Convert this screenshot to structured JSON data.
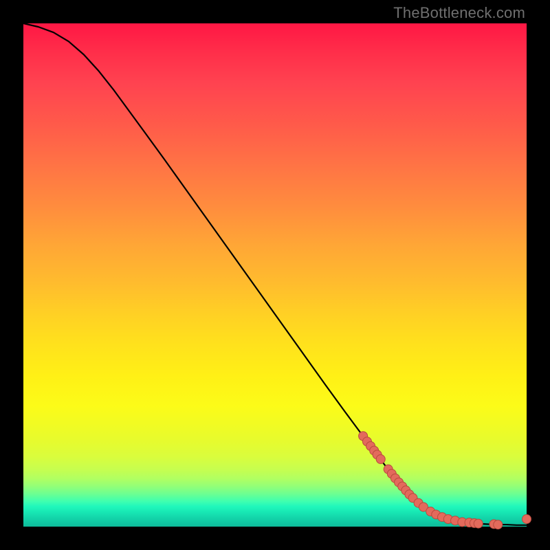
{
  "watermark": "TheBottleneck.com",
  "colors": {
    "curve": "#000000",
    "dot_fill": "#e36a5c",
    "dot_stroke": "#b94a3e"
  },
  "chart_data": {
    "type": "line",
    "title": "",
    "xlabel": "",
    "ylabel": "",
    "xlim": [
      0,
      100
    ],
    "ylim": [
      0,
      100
    ],
    "curve": [
      {
        "x": 0,
        "y": 100
      },
      {
        "x": 3,
        "y": 99.3
      },
      {
        "x": 6,
        "y": 98.2
      },
      {
        "x": 9,
        "y": 96.4
      },
      {
        "x": 12,
        "y": 93.8
      },
      {
        "x": 15,
        "y": 90.5
      },
      {
        "x": 18,
        "y": 86.7
      },
      {
        "x": 21,
        "y": 82.6
      },
      {
        "x": 24,
        "y": 78.5
      },
      {
        "x": 28,
        "y": 73.0
      },
      {
        "x": 32,
        "y": 67.4
      },
      {
        "x": 36,
        "y": 61.8
      },
      {
        "x": 40,
        "y": 56.2
      },
      {
        "x": 44,
        "y": 50.6
      },
      {
        "x": 48,
        "y": 45.0
      },
      {
        "x": 52,
        "y": 39.4
      },
      {
        "x": 56,
        "y": 33.8
      },
      {
        "x": 60,
        "y": 28.2
      },
      {
        "x": 64,
        "y": 22.7
      },
      {
        "x": 68,
        "y": 17.3
      },
      {
        "x": 72,
        "y": 12.0
      },
      {
        "x": 75,
        "y": 8.3
      },
      {
        "x": 78,
        "y": 5.2
      },
      {
        "x": 80,
        "y": 3.6
      },
      {
        "x": 82,
        "y": 2.4
      },
      {
        "x": 84,
        "y": 1.6
      },
      {
        "x": 86,
        "y": 1.1
      },
      {
        "x": 88,
        "y": 0.8
      },
      {
        "x": 90,
        "y": 0.6
      },
      {
        "x": 92,
        "y": 0.5
      },
      {
        "x": 94,
        "y": 0.4
      },
      {
        "x": 96,
        "y": 0.4
      },
      {
        "x": 98,
        "y": 0.3
      },
      {
        "x": 100,
        "y": 0.3
      }
    ],
    "dots": [
      {
        "x": 67.5,
        "y": 18.0
      },
      {
        "x": 68.3,
        "y": 16.9
      },
      {
        "x": 69.0,
        "y": 16.0
      },
      {
        "x": 69.7,
        "y": 15.1
      },
      {
        "x": 70.3,
        "y": 14.3
      },
      {
        "x": 71.0,
        "y": 13.4
      },
      {
        "x": 72.5,
        "y": 11.4
      },
      {
        "x": 73.2,
        "y": 10.5
      },
      {
        "x": 73.9,
        "y": 9.6
      },
      {
        "x": 74.6,
        "y": 8.8
      },
      {
        "x": 75.3,
        "y": 8.0
      },
      {
        "x": 76.0,
        "y": 7.2
      },
      {
        "x": 76.7,
        "y": 6.4
      },
      {
        "x": 77.4,
        "y": 5.7
      },
      {
        "x": 78.5,
        "y": 4.7
      },
      {
        "x": 79.5,
        "y": 3.9
      },
      {
        "x": 80.9,
        "y": 3.0
      },
      {
        "x": 82.0,
        "y": 2.4
      },
      {
        "x": 83.2,
        "y": 1.9
      },
      {
        "x": 84.4,
        "y": 1.5
      },
      {
        "x": 85.8,
        "y": 1.2
      },
      {
        "x": 87.2,
        "y": 0.9
      },
      {
        "x": 88.6,
        "y": 0.8
      },
      {
        "x": 89.6,
        "y": 0.7
      },
      {
        "x": 90.4,
        "y": 0.6
      },
      {
        "x": 93.5,
        "y": 0.5
      },
      {
        "x": 94.3,
        "y": 0.4
      },
      {
        "x": 100.0,
        "y": 1.5
      }
    ]
  }
}
